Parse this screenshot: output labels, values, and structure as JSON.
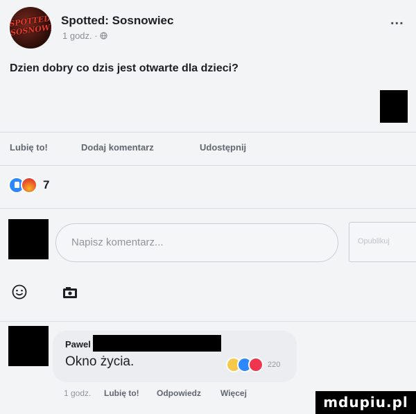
{
  "post": {
    "page_name": "Spotted: Sosnowiec",
    "avatar_logo_text": "SPOTTED SOSNOWIEC",
    "time": "1 godz. · ",
    "audience_icon": "globe-icon",
    "more_label": "...",
    "text": "Dzien dobry co dzis jest otwarte dla dzieci?"
  },
  "actions": {
    "like": "Lubię to!",
    "comment": "Dodaj komentarz",
    "share": "Udostępnij"
  },
  "reactions": {
    "icons": [
      "like-reaction-icon",
      "angry-reaction-icon"
    ],
    "count": "7"
  },
  "composer": {
    "placeholder": "Napisz komentarz...",
    "publish": "Opublikuj",
    "icons": [
      "emoji-icon",
      "camera-icon"
    ]
  },
  "comment": {
    "author": "Pawel",
    "text": "Okno życia.",
    "reaction_icons": [
      "haha-reaction-icon",
      "like-reaction-icon",
      "love-reaction-icon"
    ],
    "reaction_count": "220",
    "time": "1 godz.",
    "like": "Lubię to!",
    "reply": "Odpowiedz",
    "more": "Więcej"
  },
  "watermark": "mdupiu.pl",
  "colors": {
    "background": "#f3f4f6",
    "like_blue": "#2d88ff",
    "text_dark": "#1c1e21",
    "text_muted": "#8a8d91"
  }
}
